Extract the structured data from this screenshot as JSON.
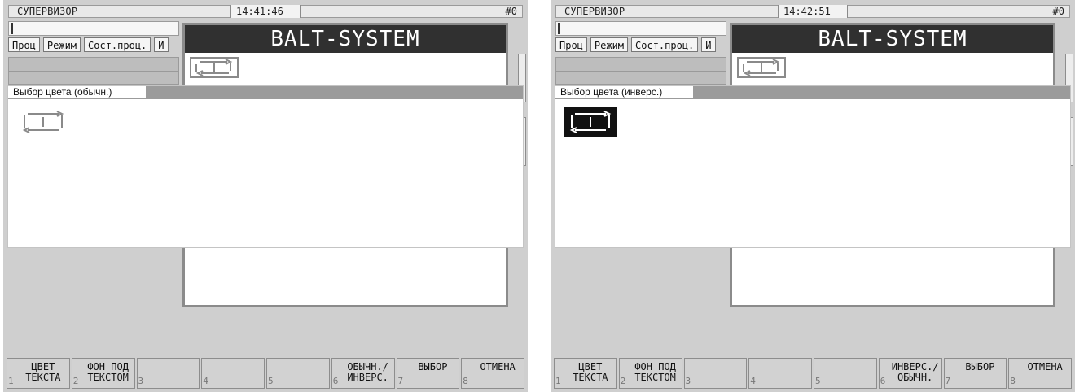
{
  "panels": [
    {
      "title": "СУПЕРВИЗОР",
      "time": "14:41:46",
      "num": "#0",
      "tabs": [
        "Проц",
        "Режим",
        "Сост.проц.",
        "И"
      ],
      "balt_title": "BALT-SYSTEM",
      "dialog_title": "Выбор цвета (обычн.)",
      "sample_mode": "normal",
      "fkeys": [
        {
          "n": "1",
          "label": "ЦВЕТ\nТЕКСТА"
        },
        {
          "n": "2",
          "label": "ФОН ПОД\nТЕКСТОМ"
        },
        {
          "n": "3",
          "label": ""
        },
        {
          "n": "4",
          "label": ""
        },
        {
          "n": "5",
          "label": ""
        },
        {
          "n": "6",
          "label": "ОБЫЧН./\nИНВЕРС."
        },
        {
          "n": "7",
          "label": "ВЫБОР"
        },
        {
          "n": "8",
          "label": "ОТМЕНА"
        }
      ]
    },
    {
      "title": "СУПЕРВИЗОР",
      "time": "14:42:51",
      "num": "#0",
      "tabs": [
        "Проц",
        "Режим",
        "Сост.проц.",
        "И"
      ],
      "balt_title": "BALT-SYSTEM",
      "dialog_title": "Выбор цвета (инверс.)",
      "sample_mode": "inverse",
      "fkeys": [
        {
          "n": "1",
          "label": "ЦВЕТ\nТЕКСТА"
        },
        {
          "n": "2",
          "label": "ФОН ПОД\nТЕКСТОМ"
        },
        {
          "n": "3",
          "label": ""
        },
        {
          "n": "4",
          "label": ""
        },
        {
          "n": "5",
          "label": ""
        },
        {
          "n": "6",
          "label": "ИНВЕРС./\nОБЫЧН."
        },
        {
          "n": "7",
          "label": "ВЫБОР"
        },
        {
          "n": "8",
          "label": "ОТМЕНА"
        }
      ]
    }
  ],
  "icons": {
    "sample_icon": "process-cycle-icon",
    "balt_icon": "process-cycle-icon"
  }
}
